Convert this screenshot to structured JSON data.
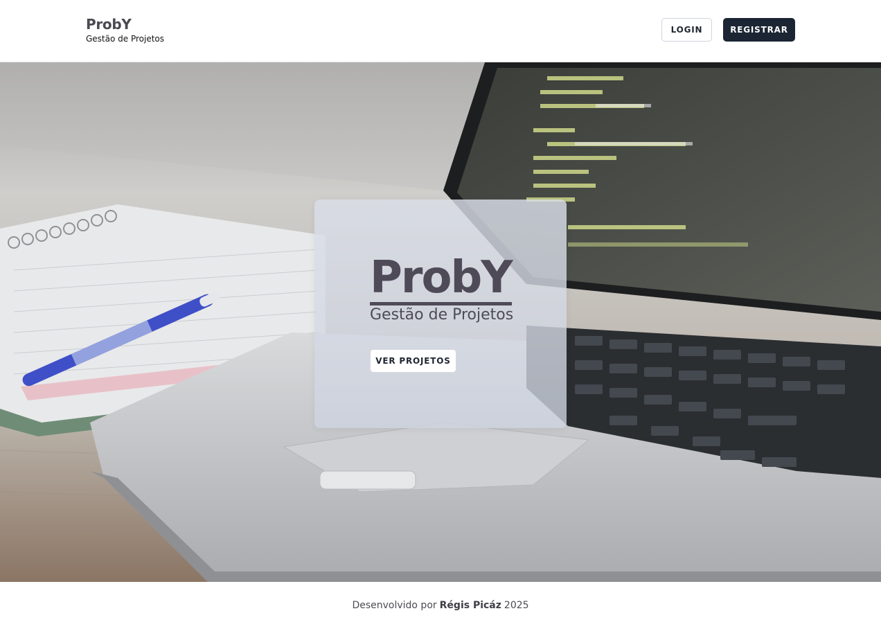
{
  "header": {
    "brand_title": "ProbY",
    "brand_subtitle": "Gestão de Projetos",
    "login_label": "LOGIN",
    "register_label": "REGISTRAR"
  },
  "hero": {
    "title": "ProbY",
    "subtitle": "Gestão de Projetos",
    "cta_label": "VER PROJETOS",
    "background_image": "laptop-and-notebook-photo"
  },
  "footer": {
    "prefix": "Desenvolvido por",
    "author": "Régis Picáz",
    "year": "2025"
  },
  "colors": {
    "brand_text": "#4f4a58",
    "primary_button": "#1b2533",
    "card_background": "#dadee8"
  }
}
